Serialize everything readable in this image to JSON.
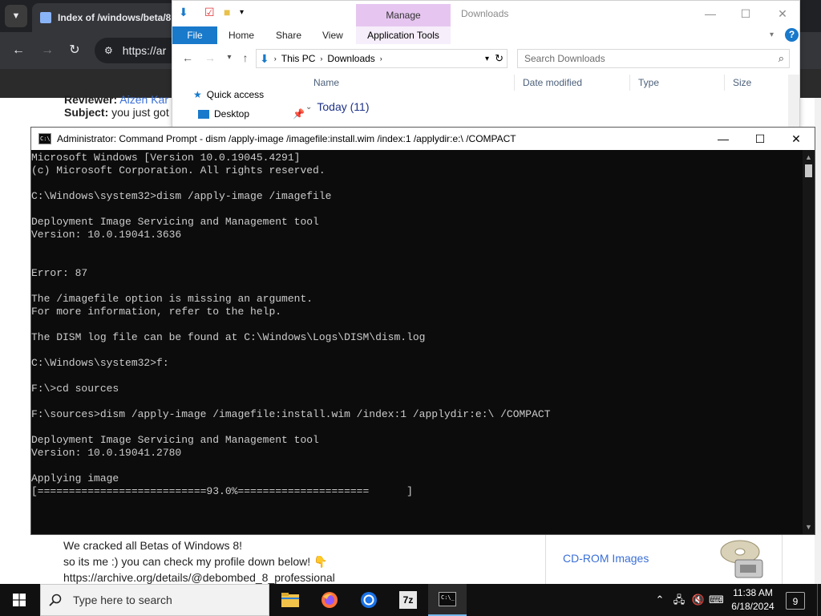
{
  "browser": {
    "tab_title": "Index of /windows/beta/8",
    "url": "https://ar",
    "reviewer_label": "Reviewer:",
    "reviewer_name": "Aizen Kar",
    "subject_label": "Subject:",
    "subject_text": "you just got",
    "post_lines": [
      "We cracked all Betas of Windows 8!",
      "so its me :) you can check my profile down below!"
    ],
    "profile_link": "https://archive.org/details/@debombed_8_professional",
    "sidebar_link": "CD-ROM Images"
  },
  "explorer": {
    "window_title": "Downloads",
    "manage_tab": "Manage",
    "tabs": [
      "Home",
      "Share",
      "View"
    ],
    "file_tab": "File",
    "app_tools_tab": "Application Tools",
    "breadcrumb": [
      "This PC",
      "Downloads"
    ],
    "search_placeholder": "Search Downloads",
    "nav_items": [
      "Quick access",
      "Desktop"
    ],
    "columns": [
      "Name",
      "Date modified",
      "Type",
      "Size"
    ],
    "group_label": "Today (11)"
  },
  "cmd": {
    "title": "Administrator: Command Prompt - dism  /apply-image /imagefile:install.wim /index:1 /applydir:e:\\ /COMPACT",
    "lines": [
      "Microsoft Windows [Version 10.0.19045.4291]",
      "(c) Microsoft Corporation. All rights reserved.",
      "",
      "C:\\Windows\\system32>dism /apply-image /imagefile",
      "",
      "Deployment Image Servicing and Management tool",
      "Version: 10.0.19041.3636",
      "",
      "",
      "Error: 87",
      "",
      "The /imagefile option is missing an argument.",
      "For more information, refer to the help.",
      "",
      "The DISM log file can be found at C:\\Windows\\Logs\\DISM\\dism.log",
      "",
      "C:\\Windows\\system32>f:",
      "",
      "F:\\>cd sources",
      "",
      "F:\\sources>dism /apply-image /imagefile:install.wim /index:1 /applydir:e:\\ /COMPACT",
      "",
      "Deployment Image Servicing and Management tool",
      "Version: 10.0.19041.2780",
      "",
      "Applying image",
      "[===========================93.0%=====================      ]"
    ],
    "progress_percent": 93.0
  },
  "taskbar": {
    "search_placeholder": "Type here to search",
    "time": "11:38 AM",
    "date": "6/18/2024",
    "notification_count": "9",
    "app_7z_label": "7z"
  },
  "colors": {
    "accent": "#1979ca",
    "manage_tab": "#e6c6f0",
    "cmd_bg": "#0c0c0c",
    "cmd_text": "#cccccc",
    "taskbar": "#101010",
    "link": "#3a6fd8"
  }
}
